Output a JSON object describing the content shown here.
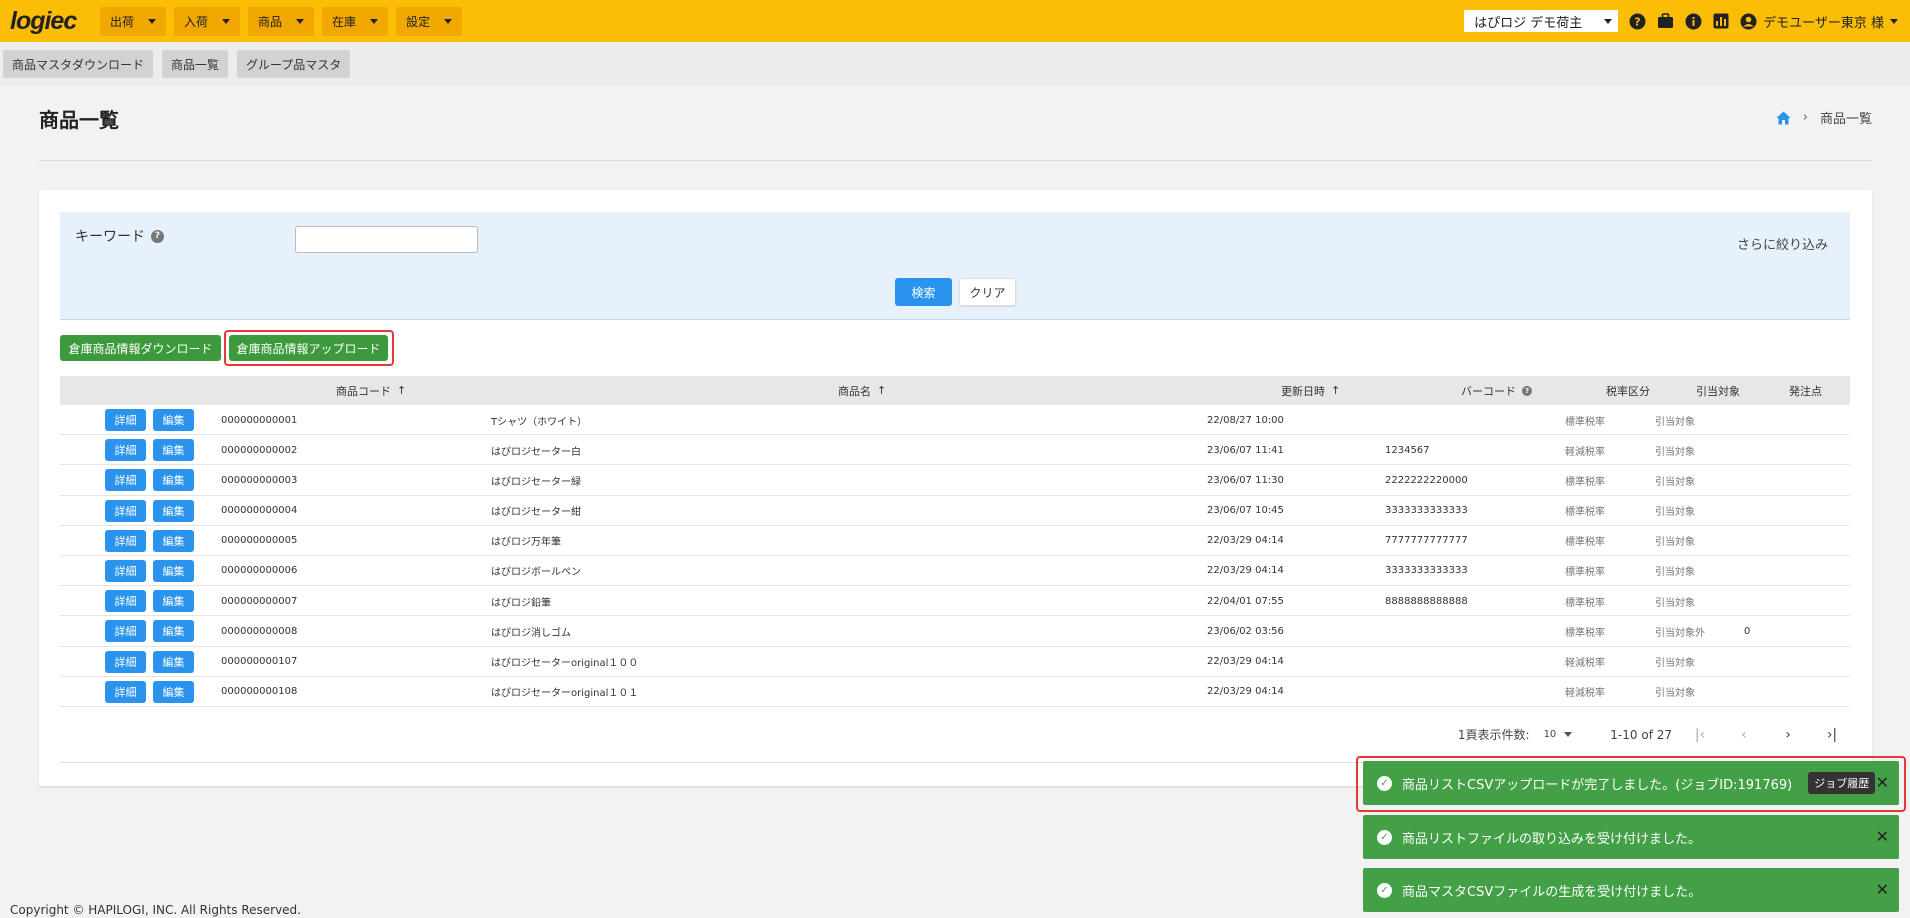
{
  "app": {
    "logo": "logiec",
    "nav": [
      {
        "label": "出荷"
      },
      {
        "label": "入荷"
      },
      {
        "label": "商品"
      },
      {
        "label": "在庫"
      },
      {
        "label": "設定"
      }
    ],
    "shipper": "はぴロジ デモ荷主",
    "user": "デモユーザー東京 様"
  },
  "subnav": [
    "商品マスタダウンロード",
    "商品一覧",
    "グループ品マスタ"
  ],
  "page": {
    "title": "商品一覧",
    "breadcrumb_current": "商品一覧"
  },
  "filter": {
    "keyword_label": "キーワード",
    "keyword_value": "",
    "more_label": "さらに絞り込み",
    "search_label": "検索",
    "clear_label": "クリア"
  },
  "actions": {
    "download_label": "倉庫商品情報ダウンロード",
    "upload_label": "倉庫商品情報アップロード"
  },
  "table": {
    "headers": {
      "code": "商品コード",
      "name": "商品名",
      "updated": "更新日時",
      "barcode": "バーコード",
      "tax": "税率区分",
      "alloc": "引当対象",
      "reorder": "発注点"
    },
    "detail_label": "詳細",
    "edit_label": "編集",
    "rows": [
      {
        "code": "000000000001",
        "name": "Tシャツ（ホワイト）",
        "updated": "22/08/27 10:00",
        "barcode": "",
        "tax": "標準税率",
        "alloc": "引当対象",
        "reorder": ""
      },
      {
        "code": "000000000002",
        "name": "はぴロジセーター白",
        "updated": "23/06/07 11:41",
        "barcode": "1234567",
        "tax": "軽減税率",
        "alloc": "引当対象",
        "reorder": ""
      },
      {
        "code": "000000000003",
        "name": "はぴロジセーター緑",
        "updated": "23/06/07 11:30",
        "barcode": "2222222220000",
        "tax": "標準税率",
        "alloc": "引当対象",
        "reorder": ""
      },
      {
        "code": "000000000004",
        "name": "はぴロジセーター紺",
        "updated": "23/06/07 10:45",
        "barcode": "3333333333333",
        "tax": "標準税率",
        "alloc": "引当対象",
        "reorder": ""
      },
      {
        "code": "000000000005",
        "name": "はぴロジ万年筆",
        "updated": "22/03/29 04:14",
        "barcode": "7777777777777",
        "tax": "標準税率",
        "alloc": "引当対象",
        "reorder": ""
      },
      {
        "code": "000000000006",
        "name": "はぴロジボールペン",
        "updated": "22/03/29 04:14",
        "barcode": "3333333333333",
        "tax": "標準税率",
        "alloc": "引当対象",
        "reorder": ""
      },
      {
        "code": "000000000007",
        "name": "はぴロジ鉛筆",
        "updated": "22/04/01 07:55",
        "barcode": "8888888888888",
        "tax": "標準税率",
        "alloc": "引当対象",
        "reorder": ""
      },
      {
        "code": "000000000008",
        "name": "はぴロジ消しゴム",
        "updated": "23/06/02 03:56",
        "barcode": "",
        "tax": "標準税率",
        "alloc": "引当対象外",
        "reorder": "0"
      },
      {
        "code": "000000000107",
        "name": "はぴロジセーターoriginal１００",
        "updated": "22/03/29 04:14",
        "barcode": "",
        "tax": "軽減税率",
        "alloc": "引当対象",
        "reorder": ""
      },
      {
        "code": "000000000108",
        "name": "はぴロジセーターoriginal１０１",
        "updated": "22/03/29 04:14",
        "barcode": "",
        "tax": "軽減税率",
        "alloc": "引当対象",
        "reorder": ""
      }
    ]
  },
  "pagination": {
    "rows_per_page_label": "1頁表示件数:",
    "rows_per_page": "10",
    "range": "1-10 of 27"
  },
  "toasts": [
    {
      "message": "商品リストCSVアップロードが完了しました。(ジョブID:191769)",
      "action": "ジョブ履歴"
    },
    {
      "message": "商品リストファイルの取り込みを受け付けました。"
    },
    {
      "message": "商品マスタCSVファイルの生成を受け付けました。"
    }
  ],
  "footer": {
    "copyright": "Copyright © HAPILOGI, INC. All Rights Reserved."
  },
  "colors": {
    "topbar": "#fcbd07",
    "primary": "#2a93ee",
    "success": "#43a047",
    "highlight": "#e53935"
  }
}
